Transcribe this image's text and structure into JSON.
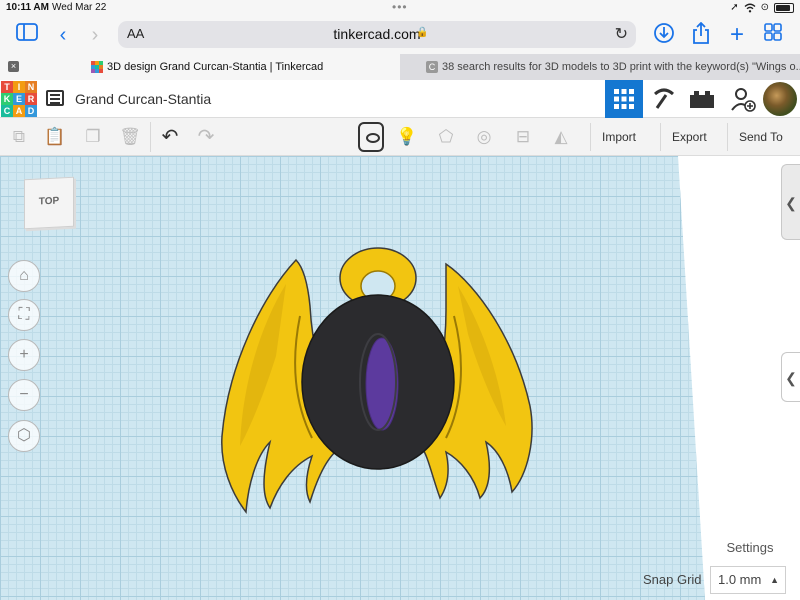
{
  "status_bar": {
    "time": "10:11 AM",
    "date": "Wed Mar 22",
    "dots": "•••"
  },
  "safari": {
    "text_size_label": "AA",
    "url": "tinkercad.com",
    "lock": "🔒",
    "reload": "↻",
    "icons": {
      "sidebar": "sidebar-icon",
      "back": "chevron-left-icon",
      "forward": "chevron-right-icon",
      "download": "download-icon",
      "share": "share-icon",
      "new_tab": "plus-icon",
      "tabs": "tabs-grid-icon"
    }
  },
  "tabs": [
    {
      "title": "3D design Grand Curcan-Stantia | Tinkercad",
      "active": true
    },
    {
      "title": "38 search results for 3D models to 3D print with the keyword(s) \"Wings o...",
      "active": false
    }
  ],
  "tinkercad": {
    "logo_letters": [
      "T",
      "I",
      "N",
      "K",
      "E",
      "R",
      "C",
      "A",
      "D"
    ],
    "logo_colors": [
      "#e74c3c",
      "#f39c12",
      "#e67e22",
      "#2ecc71",
      "#3498db",
      "#e74c3c",
      "#1abc9c",
      "#f39c12",
      "#3498db"
    ],
    "design_title": "Grand Curcan-Stantia",
    "views": [
      "3d-design-view",
      "codeblocks-view",
      "bricks-view"
    ],
    "accent_color": "#1477d1"
  },
  "toolbar": {
    "import_label": "Import",
    "export_label": "Export",
    "send_to_label": "Send To"
  },
  "workplane": {
    "viewcube_label": "TOP",
    "settings_label": "Settings",
    "snap_grid_label": "Snap Grid",
    "snap_grid_value": "1.0 mm",
    "grid_color": "#cfe7f1",
    "model_colors": {
      "wings": "#f2c511",
      "body": "#2b2b2e",
      "eye": "#5c3a9e"
    }
  }
}
